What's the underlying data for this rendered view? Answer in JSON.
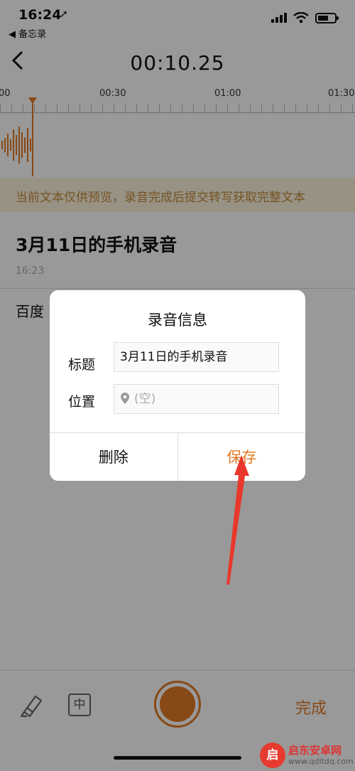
{
  "status_bar": {
    "time": "16:24",
    "back_app": "◀ 备忘录"
  },
  "nav": {
    "timer": "00:10.25"
  },
  "ruler": {
    "labels": [
      "00",
      "00:30",
      "01:00",
      "01:30"
    ]
  },
  "banner": {
    "text": "当前文本仅供预览，录音完成后提交转写获取完整文本"
  },
  "note": {
    "title": "3月11日的手机录音",
    "time": "16:23",
    "body": "百度"
  },
  "dialog": {
    "title": "录音信息",
    "title_label": "标题",
    "title_value": "3月11日的手机录音",
    "location_label": "位置",
    "location_placeholder": "(空)",
    "delete_label": "删除",
    "save_label": "保存"
  },
  "toolbar": {
    "lang_label": "中",
    "done_label": "完成"
  },
  "watermark": {
    "name": "启东安卓网",
    "url": "www.qdltdq.com",
    "logo_char": "启"
  },
  "colors": {
    "accent": "#e27a24",
    "banner_bg": "#fcf4dd",
    "banner_text": "#c48a3a",
    "annotation": "#e8382c"
  }
}
